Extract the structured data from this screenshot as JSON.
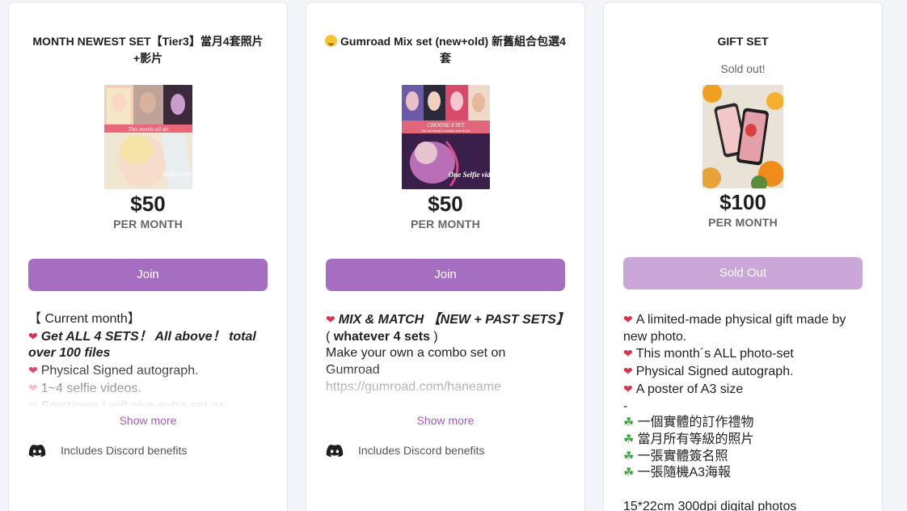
{
  "cards": [
    {
      "title": "MONTH NEWEST SET【Tier3】當月4套照片+影片",
      "thumb_caption": "This month all set",
      "thumb_overlay": "Selfie video",
      "price": "$50",
      "period": "PER MONTH",
      "button": "Join",
      "desc": [
        "【 Current month】",
        "Get ALL 4 SETS！  All above！ total over 100 files",
        "Physical Signed autograph.",
        "1~4 selfie videos.",
        "Somtimes I will give extra set as"
      ],
      "show_more": "Show more",
      "discord": "Includes Discord benefits"
    },
    {
      "title": "Gumroad Mix set (new+old) 新舊組合包選4套",
      "thumb_caption": "CHOOSE 4 SET",
      "thumb_sub": "You can change to random past set too",
      "thumb_overlay": "One Selfie video",
      "price": "$50",
      "period": "PER MONTH",
      "button": "Join",
      "desc": [
        "MIX & MATCH 【NEW + PAST SETS】",
        "whatever 4 sets",
        "Make your own a combo set on",
        "Gumroad",
        "https://gumroad.com/haneame"
      ],
      "show_more": "Show more",
      "discord": "Includes Discord benefits"
    },
    {
      "title": "GIFT SET",
      "status_note": "Sold out!",
      "price": "$100",
      "period": "PER MONTH",
      "button": "Sold Out",
      "desc": [
        "A limited-made physical gift made by new photo.",
        "This month´s ALL photo-set",
        "Physical Signed autograph.",
        "A poster of A3 size",
        "-",
        "一個實體的訂作禮物",
        "當月所有等級的照片",
        "一張實體簽名照",
        "一張隨機A3海報",
        "",
        "15*22cm 300dpi digital photos"
      ]
    }
  ],
  "colors": {
    "accent": "#a56ec0",
    "accent_disabled": "#cba6d9",
    "link": "#9b5fb5",
    "heart": "#d6334f",
    "clover": "#3ba63b"
  },
  "icons": [
    "heart-icon",
    "clover-icon",
    "discord-icon",
    "smile-emoji-icon"
  ]
}
